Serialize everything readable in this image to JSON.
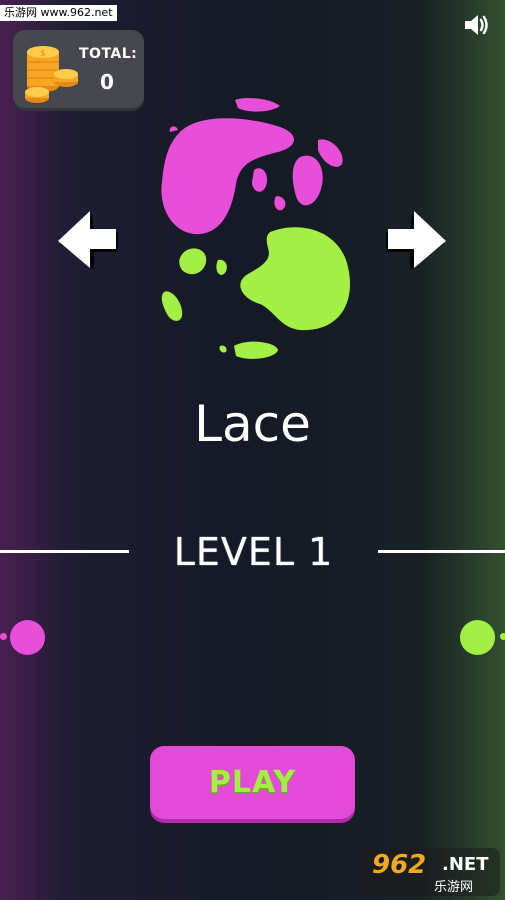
{
  "watermark_top": "乐游网 www.962.net",
  "coins": {
    "label": "TOTAL:",
    "value": "0"
  },
  "skin": {
    "name": "Lace",
    "colors": {
      "primary": "#e84fd9",
      "secondary": "#a3ef45"
    }
  },
  "level": {
    "text": "LEVEL 1"
  },
  "play_button": {
    "label": "PLAY"
  },
  "icons": {
    "sound": "speaker-volume-icon",
    "coins": "coin-stack-icon",
    "prev": "arrow-left-icon",
    "next": "arrow-right-icon"
  },
  "watermark_bottom": {
    "number": "962",
    "suffix": ".NET",
    "chinese": "乐游网"
  }
}
